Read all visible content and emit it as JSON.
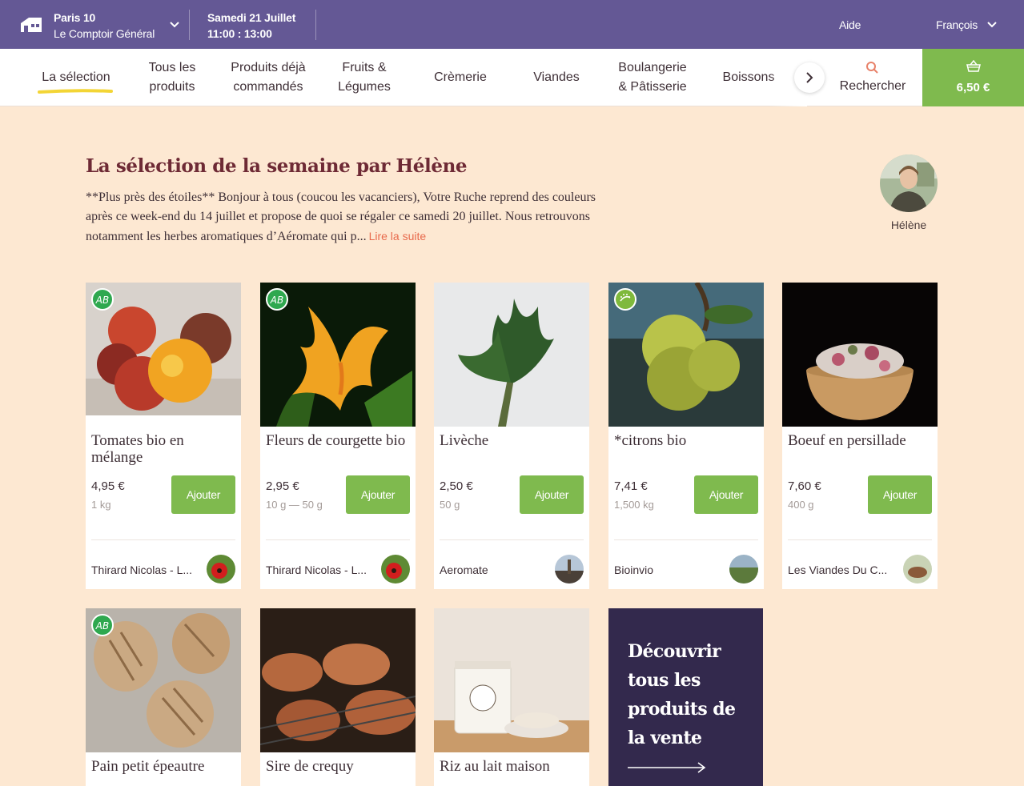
{
  "header": {
    "hive_city": "Paris 10",
    "hive_name": "Le Comptoir Général",
    "date": "Samedi 21 Juillet",
    "time": "11:00 : 13:00",
    "help": "Aide",
    "language": "François"
  },
  "nav": {
    "items": [
      {
        "line1": "La sélection",
        "line2": ""
      },
      {
        "line1": "Tous les",
        "line2": "produits"
      },
      {
        "line1": "Produits déjà",
        "line2": "commandés"
      },
      {
        "line1": "Fruits &",
        "line2": "Légumes"
      },
      {
        "line1": "Crèmerie",
        "line2": ""
      },
      {
        "line1": "Viandes",
        "line2": ""
      },
      {
        "line1": "Boulangerie",
        "line2": "& Pâtisserie"
      },
      {
        "line1": "Boissons",
        "line2": ""
      }
    ],
    "search": "Rechercher",
    "cart_total": "6,50 €"
  },
  "selection": {
    "title": "La sélection de la semaine par Hélène",
    "text": "**Plus près des étoiles** Bonjour à tous (coucou les vacanciers), Votre Ruche reprend des couleurs après ce week-end du 14 juillet et propose de quoi se régaler ce samedi 20 juillet. Nous retrouvons notamment les herbes aromatiques d’Aéromate qui p...",
    "read_more": "Lire la suite",
    "curator": "Hélène"
  },
  "products": [
    {
      "name": "Tomates bio en mélange",
      "price": "4,95 €",
      "quantity": "1 kg",
      "add": "Ajouter",
      "producer": "Thirard Nicolas - L...",
      "badge": "AB"
    },
    {
      "name": "Fleurs de courgette bio",
      "price": "2,95 €",
      "quantity": "10 g — 50 g",
      "add": "Ajouter",
      "producer": "Thirard Nicolas - L...",
      "badge": "AB"
    },
    {
      "name": "Livèche",
      "price": "2,50 €",
      "quantity": "50 g",
      "add": "Ajouter",
      "producer": "Aeromate",
      "badge": ""
    },
    {
      "name": "*citrons bio",
      "price": "7,41 €",
      "quantity": "1,500 kg",
      "add": "Ajouter",
      "producer": "Bioinvio",
      "badge": "eu-organic"
    },
    {
      "name": "Boeuf en persillade",
      "price": "7,60 €",
      "quantity": "400 g",
      "add": "Ajouter",
      "producer": "Les Viandes Du C...",
      "badge": ""
    },
    {
      "name": "Pain petit épeautre",
      "badge": "AB"
    },
    {
      "name": "Sire de crequy",
      "badge": ""
    },
    {
      "name": "Riz au lait maison",
      "badge": ""
    }
  ],
  "discover": {
    "text": "Découvrir tous les produits de la vente"
  },
  "colors": {
    "header": "#645895",
    "accent_green": "#7fba4e",
    "title_wine": "#6e2a35",
    "background": "#fde8d2",
    "discover_bg": "#33294d",
    "link": "#e86a4c"
  }
}
